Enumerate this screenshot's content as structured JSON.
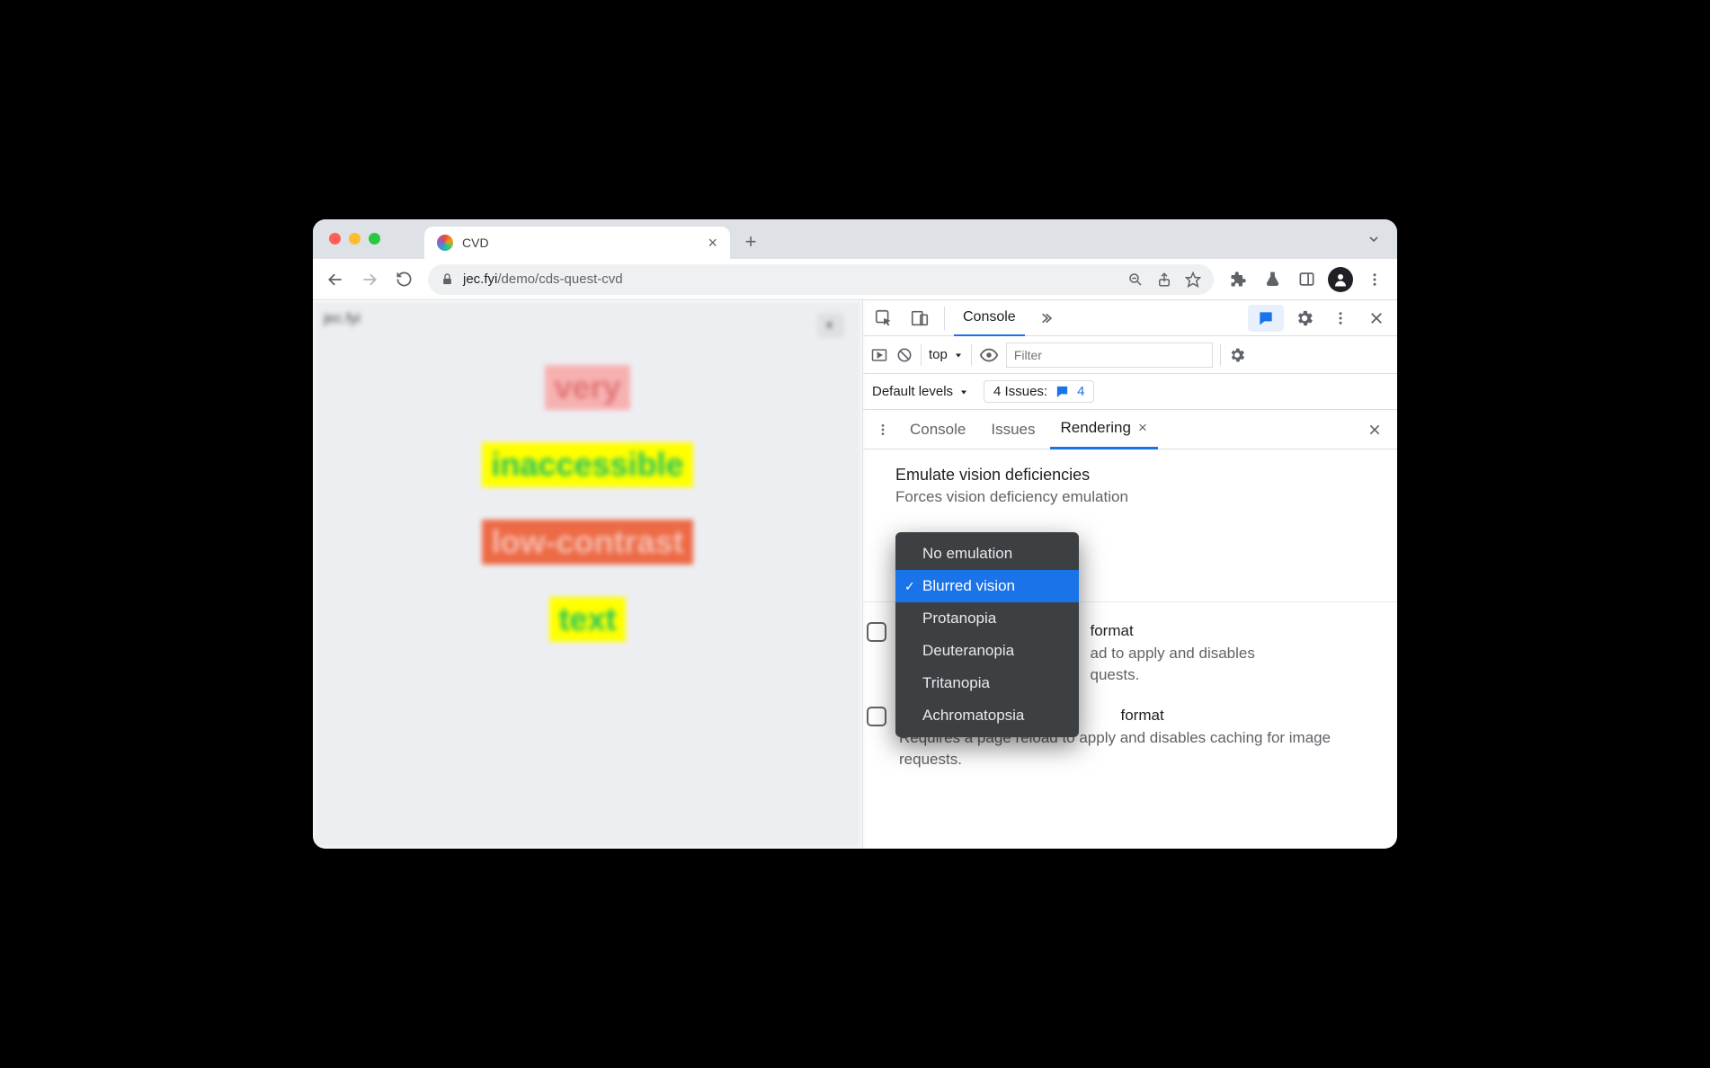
{
  "browser": {
    "tab_title": "CVD",
    "url_host": "jec.fyi",
    "url_path": "/demo/cds-quest-cvd"
  },
  "page": {
    "site_label": "jec.fyi",
    "words": [
      "very",
      "inaccessible",
      "low-contrast",
      "text"
    ]
  },
  "devtools": {
    "main_tab": "Console",
    "context": "top",
    "filter_placeholder": "Filter",
    "default_levels": "Default levels",
    "issues_label": "4 Issues:",
    "issues_count": "4",
    "drawer_tabs": {
      "console": "Console",
      "issues": "Issues",
      "rendering": "Rendering"
    },
    "section": {
      "title": "Emulate vision deficiencies",
      "subtitle": "Forces vision deficiency emulation"
    },
    "dropdown": {
      "options": [
        "No emulation",
        "Blurred vision",
        "Protanopia",
        "Deuteranopia",
        "Tritanopia",
        "Achromatopsia"
      ],
      "selected_index": 1
    },
    "opt1": {
      "suffix": "format",
      "desc": "ad to apply and disables",
      "desc2": "quests."
    },
    "opt2": {
      "suffix": "format",
      "desc_full": "Requires a page reload to apply and disables caching for image requests."
    }
  }
}
